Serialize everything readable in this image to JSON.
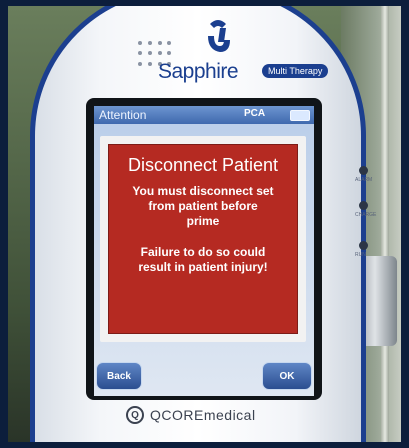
{
  "device": {
    "brand": "Sapphire",
    "brand_badge": "Multi Therapy",
    "manufacturer": "QCOREmedical",
    "manufacturer_mark": "Q"
  },
  "screen": {
    "header_title": "Attention",
    "mode": "PCA",
    "alert": {
      "title": "Disconnect Patient",
      "message_lines": [
        "You must disconnect set",
        "from patient before",
        "prime"
      ],
      "warning_lines": [
        "Failure to do so could",
        "result in patient injury!"
      ]
    },
    "buttons": {
      "back_label": "Back",
      "ok_label": "OK"
    }
  },
  "indicators": {
    "alarm": "ALARM",
    "charge": "CHARGE",
    "run": "RUN"
  },
  "colors": {
    "alert_red": "#b52a22",
    "brand_blue": "#1b3f8f",
    "button_blue": "#2b4e90"
  }
}
